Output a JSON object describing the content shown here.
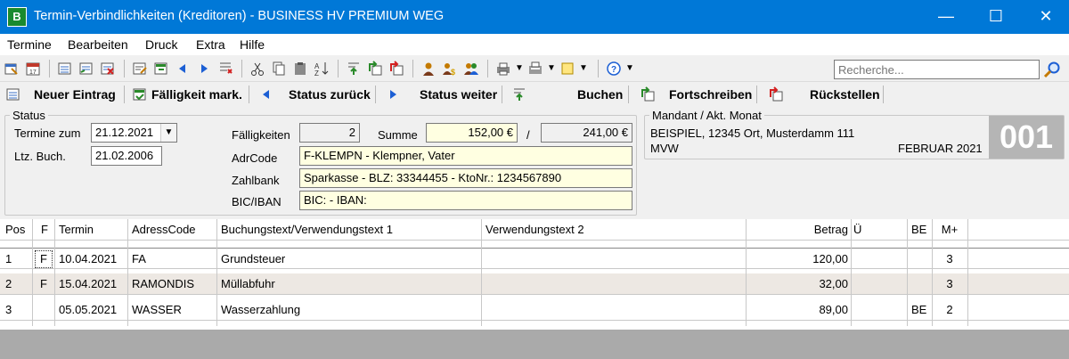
{
  "window": {
    "app_icon_letter": "B",
    "title": "Termin-Verbindlichkeiten (Kreditoren) - BUSINESS HV PREMIUM WEG",
    "minimize_glyph": "—",
    "maximize_glyph": "☐",
    "close_glyph": "✕"
  },
  "menu": [
    "Termine",
    "Bearbeiten",
    "Druck",
    "Extra",
    "Hilfe"
  ],
  "search": {
    "placeholder": "Recherche..."
  },
  "actions": {
    "new_entry": "Neuer Eintrag",
    "due_mark": "Fälligkeit mark.",
    "status_back": "Status zurück",
    "status_forward": "Status weiter",
    "book": "Buchen",
    "carry_forward": "Fortschreiben",
    "reset": "Rückstellen"
  },
  "status_group": {
    "legend": "Status",
    "termine_zum_label": "Termine zum",
    "termine_zum_value": "21.12.2021",
    "ltz_buch_label": "Ltz. Buch.",
    "ltz_buch_value": "21.02.2006",
    "faelligkeiten_label": "Fälligkeiten",
    "faelligkeiten_value": "2",
    "summe_label": "Summe",
    "summe_value": "152,00 €",
    "summe_separator": "/",
    "summe_total": "241,00 €",
    "adrcode_label": "AdrCode",
    "adrcode_value": "F-KLEMPN - Klempner, Vater",
    "zahlbank_label": "Zahlbank",
    "zahlbank_value": "Sparkasse - BLZ: 33344455 - KtoNr.: 1234567890",
    "bic_iban_label": "BIC/IBAN",
    "bic_iban_value": "BIC:  - IBAN:"
  },
  "mandant_group": {
    "legend": "Mandant / Akt. Monat",
    "line1": "BEISPIEL, 12345 Ort, Musterdamm 111",
    "line2": "MVW",
    "month": "FEBRUAR 2021",
    "number": "001"
  },
  "table": {
    "headers": {
      "pos": "Pos",
      "f": "F",
      "termin": "Termin",
      "adresscode": "AdressCode",
      "text1": "Buchungstext/Verwendungstext 1",
      "text2": "Verwendungstext 2",
      "betrag": "Betrag",
      "ue": "Ü",
      "be": "BE",
      "mplus": "M+"
    },
    "rows": [
      {
        "pos": "1",
        "f": "F",
        "termin": "10.04.2021",
        "adresscode": "FA",
        "text1": "Grundsteuer",
        "text2": "",
        "betrag": "120,00",
        "ue": "",
        "be": "",
        "mplus": "3"
      },
      {
        "pos": "2",
        "f": "F",
        "termin": "15.04.2021",
        "adresscode": "RAMONDIS",
        "text1": "Müllabfuhr",
        "text2": "",
        "betrag": "32,00",
        "ue": "",
        "be": "",
        "mplus": "3"
      },
      {
        "pos": "3",
        "f": "",
        "termin": "05.05.2021",
        "adresscode": "WASSER",
        "text1": "Wasserzahlung",
        "text2": "",
        "betrag": "89,00",
        "ue": "",
        "be": "BE",
        "mplus": "2"
      }
    ]
  },
  "colors": {
    "titlebar": "#0078d7",
    "field_yellow": "#ffffe1",
    "row_alt": "#ede8e3"
  }
}
